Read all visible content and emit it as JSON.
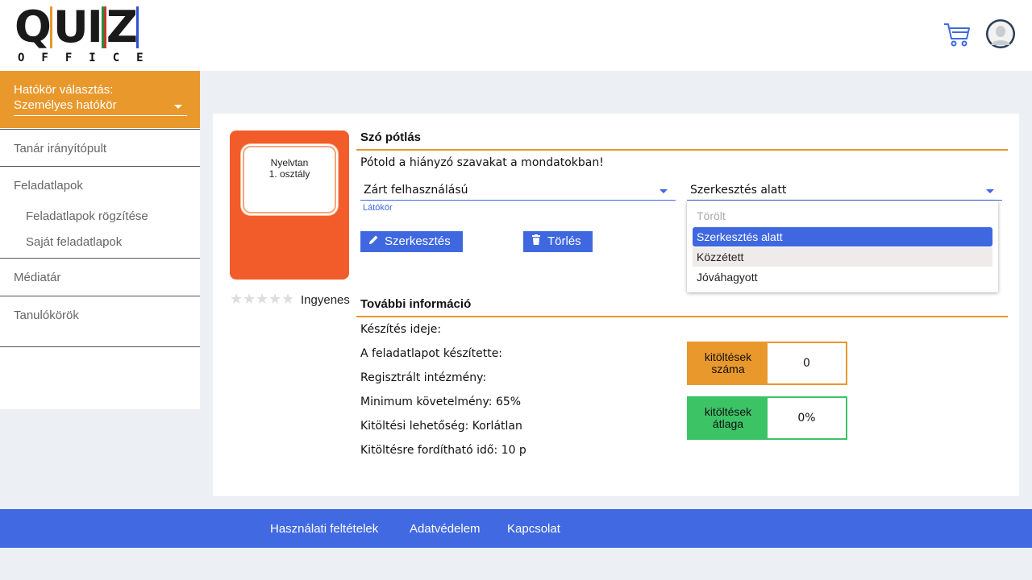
{
  "header": {
    "logo": {
      "letters": [
        "Q",
        "U",
        "I",
        "Z"
      ],
      "subtitle": "OFFICE"
    },
    "cart_icon": "cart-icon",
    "avatar_icon": "user-avatar-icon"
  },
  "sidebar": {
    "scope_label": "Hatókör választás:",
    "scope_value": "Személyes hatókör",
    "nav": {
      "dashboard": "Tanár irányítópult",
      "worksheets": "Feladatlapok",
      "worksheets_record": "Feladatlapok rögzítése",
      "worksheets_own": "Saját feladatlapok",
      "media": "Médiatár",
      "groups": "Tanulókörök"
    }
  },
  "worksheet": {
    "thumbnail": {
      "line1": "Nyelvtan",
      "line2": "1. osztály"
    },
    "rating": 0,
    "price": "Ingyenes",
    "title": "Szó pótlás",
    "description": "Pótold a hiányzó szavakat a mondatokban!",
    "access_select": "Zárt felhasználású",
    "access_hint": "Látókör",
    "status_select": "Szerkesztés alatt",
    "status_options": [
      "Törölt",
      "Szerkesztés alatt",
      "Közzétett",
      "Jóváhagyott"
    ],
    "edit_button": "Szerkesztés",
    "delete_button": "Törlés"
  },
  "more_info": {
    "title": "További információ",
    "created": "Készítés ideje:",
    "author": "A feladatlapot készítette:",
    "institution": "Regisztrált intézmény:",
    "min_req": "Minimum követelmény: 65%",
    "attempts": "Kitöltési lehetőség: Korlátlan",
    "time": "Kitöltésre fordítható idő: 10 p"
  },
  "stats": {
    "count_label_1": "kitöltések",
    "count_label_2": "száma",
    "count_value": "0",
    "avg_label_1": "kitöltések",
    "avg_label_2": "átlaga",
    "avg_value": "0%"
  },
  "footer": {
    "terms": "Használati feltételek",
    "privacy": "Adatvédelem",
    "contact": "Kapcsolat"
  },
  "colors": {
    "accent_orange": "#e9982c",
    "accent_blue": "#4169e1",
    "thumb_orange": "#f25c2a",
    "stat_green": "#3cc366"
  }
}
